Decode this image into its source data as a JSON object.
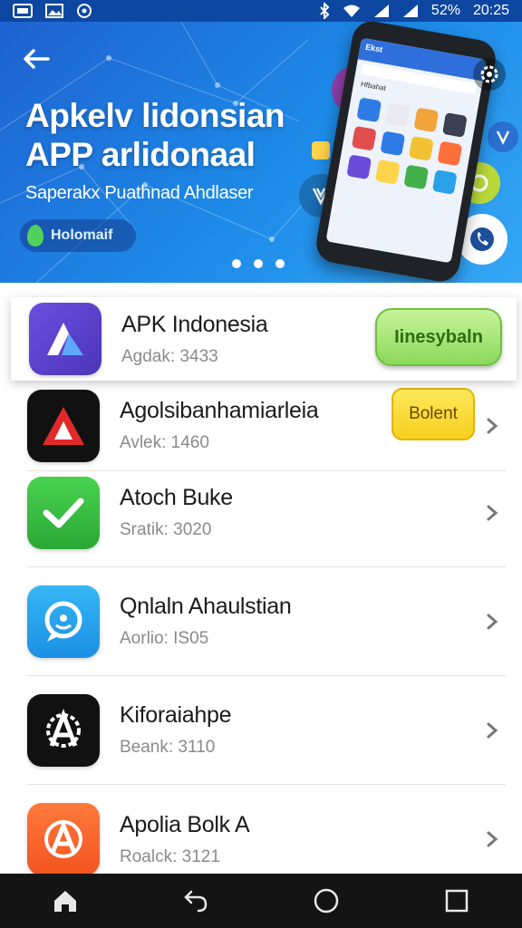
{
  "status_bar": {
    "battery_text": "52%",
    "time": "20:25"
  },
  "banner": {
    "title_line1": "Apkelv lidonsian",
    "title_line2": "APP arlidonaal",
    "subtitle": "Saperakx Puathnad Ahdlaser",
    "pill_label": "Holomaif",
    "phone_header": "Ekst",
    "phone_subheader": "Hfbahat",
    "carousel_count": 3,
    "carousel_active": 0
  },
  "featured_app": {
    "name": "APK Indonesia",
    "meta": "Agdak: 3433",
    "action_label": "Iinesybaln",
    "icon": "apk-indonesia-icon"
  },
  "apps": [
    {
      "name": "Agolsibanhamiarleia",
      "meta": "Avlek: 1460",
      "icon": "red-a-icon",
      "action_label": "Bolent"
    },
    {
      "name": "Atoch Buke",
      "meta": "Sratik: 3020",
      "icon": "checkmark-icon"
    },
    {
      "name": "Qnlaln Ahaulstian",
      "meta": "Aorlio: IS05",
      "icon": "smile-chat-icon"
    },
    {
      "name": "Kiforaiahpe",
      "meta": "Beank: 3110",
      "icon": "a-gear-icon"
    },
    {
      "name": "Apolia Bolk A",
      "meta": "Roalck: 3121",
      "icon": "orange-a-icon"
    }
  ],
  "colors": {
    "banner_start": "#1e62d0",
    "banner_end": "#36a7f5",
    "accent_green": "#8bd95a",
    "accent_yellow": "#f7cf1f"
  }
}
